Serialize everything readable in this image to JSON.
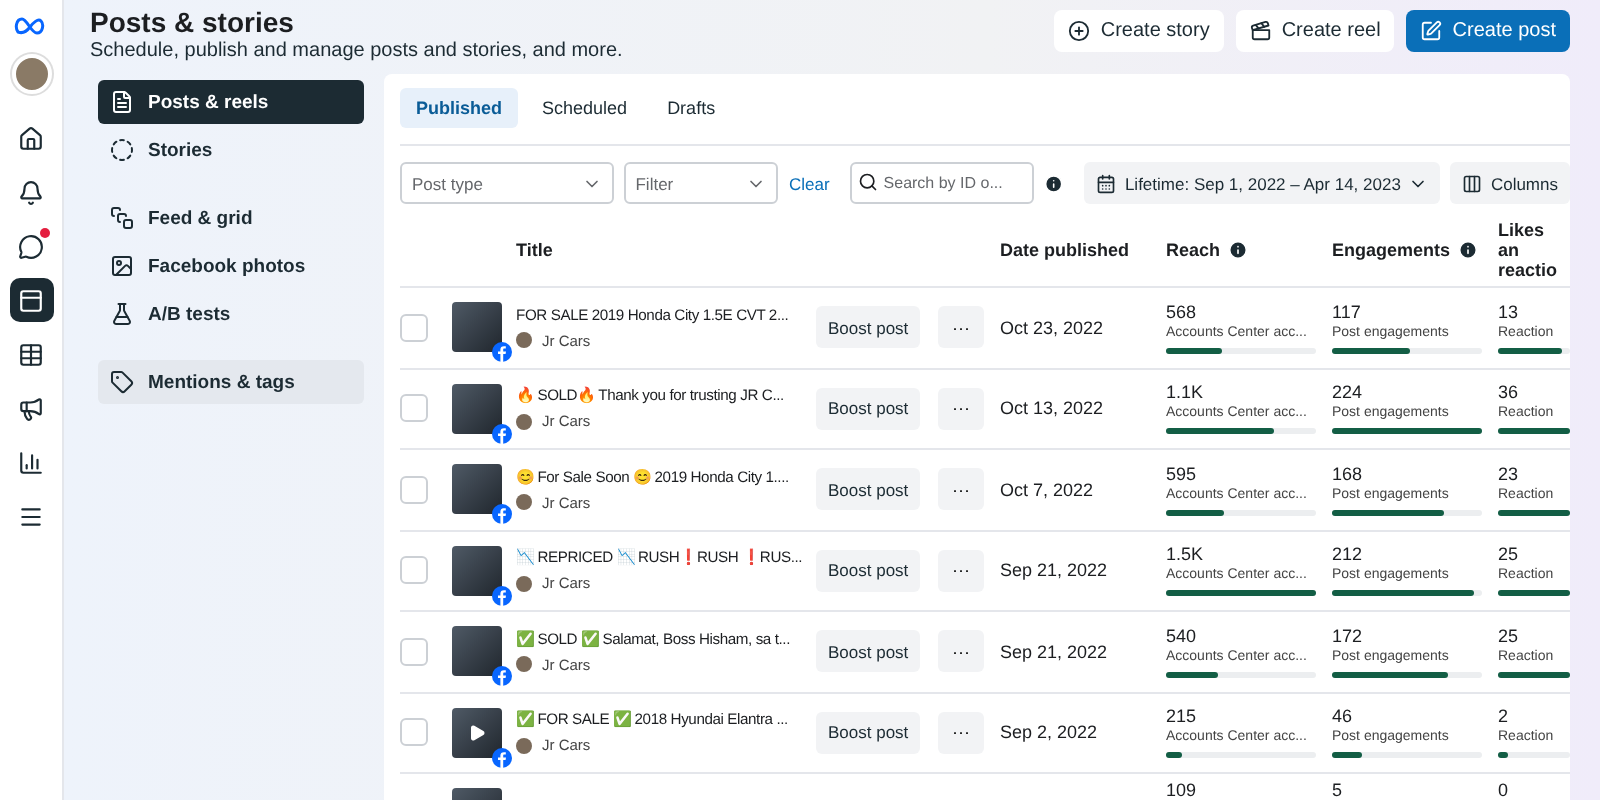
{
  "rail": [
    {
      "selected": false,
      "badge": false
    },
    {
      "selected": false,
      "badge": false
    },
    {
      "selected": false,
      "badge": true
    },
    {
      "selected": true,
      "badge": false
    },
    {
      "selected": false,
      "badge": false
    },
    {
      "selected": false,
      "badge": false
    },
    {
      "selected": false,
      "badge": false
    },
    {
      "selected": false,
      "badge": false
    }
  ],
  "header": {
    "title": "Posts & stories",
    "subtitle": "Schedule, publish and manage posts and stories, and more."
  },
  "actions": [
    {
      "label": "Create story",
      "primary": false
    },
    {
      "label": "Create reel",
      "primary": false
    },
    {
      "label": "Create post",
      "primary": true
    }
  ],
  "sidebar": [
    [
      {
        "label": "Posts & reels",
        "selected": true,
        "highlighted": false
      },
      {
        "label": "Stories",
        "selected": false,
        "highlighted": false
      }
    ],
    [
      {
        "label": "Feed & grid",
        "selected": false,
        "highlighted": false
      },
      {
        "label": "Facebook photos",
        "selected": false,
        "highlighted": false
      },
      {
        "label": "A/B tests",
        "selected": false,
        "highlighted": false
      }
    ],
    [
      {
        "label": "Mentions & tags",
        "selected": false,
        "highlighted": true
      }
    ]
  ],
  "tabs": [
    {
      "label": "Published",
      "selected": true
    },
    {
      "label": "Scheduled",
      "selected": false
    },
    {
      "label": "Drafts",
      "selected": false
    }
  ],
  "filters": {
    "post_type": {
      "placeholder": "Post type"
    },
    "filter": {
      "placeholder": "Filter"
    },
    "clear": "Clear",
    "search": {
      "placeholder": "Search by ID o..."
    },
    "date_range": "Lifetime: Sep 1, 2022 – Apr 14, 2023",
    "columns": "Columns"
  },
  "table": {
    "columns": [
      {
        "label": "Title",
        "info": false
      },
      {
        "label": "Date published",
        "info": false
      },
      {
        "label": "Reach",
        "info": true
      },
      {
        "label": "Engagements",
        "info": true
      },
      {
        "label": "Likes an reactio",
        "info": false
      }
    ],
    "rows": [
      {
        "checked": false,
        "title": "FOR SALE 2019 Honda City 1.5E CVT 2...",
        "author": "Jr Cars",
        "video": false,
        "boost": "Boost post",
        "more": "···",
        "date": "Oct 23, 2022",
        "reach": {
          "value": "568",
          "label": "Accounts Center acc...",
          "level": 0.37
        },
        "engagements": {
          "value": "117",
          "label": "Post engagements",
          "level": 0.52
        },
        "likes": {
          "value": "13",
          "label": "Reaction",
          "level": 0.9
        }
      },
      {
        "checked": false,
        "title": "🔥 SOLD🔥 Thank you for trusting JR C...",
        "author": "Jr Cars",
        "video": false,
        "boost": "Boost post",
        "more": "···",
        "date": "Oct 13, 2022",
        "reach": {
          "value": "1.1K",
          "label": "Accounts Center acc...",
          "level": 0.72
        },
        "engagements": {
          "value": "224",
          "label": "Post engagements",
          "level": 1
        },
        "likes": {
          "value": "36",
          "label": "Reaction",
          "level": 1
        }
      },
      {
        "checked": false,
        "title": "😊 For Sale Soon 😊 2019 Honda City 1....",
        "author": "Jr Cars",
        "video": false,
        "boost": "Boost post",
        "more": "···",
        "date": "Oct 7, 2022",
        "reach": {
          "value": "595",
          "label": "Accounts Center acc...",
          "level": 0.38
        },
        "engagements": {
          "value": "168",
          "label": "Post engagements",
          "level": 0.75
        },
        "likes": {
          "value": "23",
          "label": "Reaction",
          "level": 1
        }
      },
      {
        "checked": false,
        "title": "📉 REPRICED 📉 RUSH❗RUSH ❗RUS...",
        "author": "Jr Cars",
        "video": false,
        "boost": "Boost post",
        "more": "···",
        "date": "Sep 21, 2022",
        "reach": {
          "value": "1.5K",
          "label": "Accounts Center acc...",
          "level": 1
        },
        "engagements": {
          "value": "212",
          "label": "Post engagements",
          "level": 0.95
        },
        "likes": {
          "value": "25",
          "label": "Reaction",
          "level": 1
        }
      },
      {
        "checked": false,
        "title": "✅ SOLD ✅ Salamat, Boss Hisham, sa t...",
        "author": "Jr Cars",
        "video": false,
        "boost": "Boost post",
        "more": "···",
        "date": "Sep 21, 2022",
        "reach": {
          "value": "540",
          "label": "Accounts Center acc...",
          "level": 0.35
        },
        "engagements": {
          "value": "172",
          "label": "Post engagements",
          "level": 0.77
        },
        "likes": {
          "value": "25",
          "label": "Reaction",
          "level": 1
        }
      },
      {
        "checked": false,
        "title": "✅ FOR SALE ✅ 2018 Hyundai Elantra ...",
        "author": "Jr Cars",
        "video": true,
        "boost": "Boost post",
        "more": "···",
        "date": "Sep 2, 2022",
        "reach": {
          "value": "215",
          "label": "Accounts Center acc...",
          "level": 0.1
        },
        "engagements": {
          "value": "46",
          "label": "Post engagements",
          "level": 0.2
        },
        "likes": {
          "value": "2",
          "label": "Reaction",
          "level": 0.15
        }
      },
      {
        "reach": {
          "value": "109"
        },
        "engagements": {
          "value": "5"
        },
        "likes": {
          "value": "0"
        }
      }
    ]
  }
}
